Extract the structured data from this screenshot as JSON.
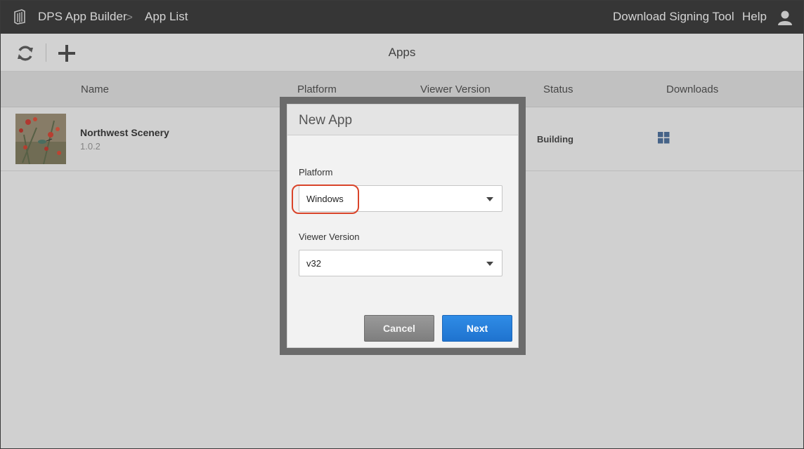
{
  "topbar": {
    "app_name": "DPS App Builder",
    "separator": ">",
    "page": "App List",
    "download_tool": "Download Signing Tool",
    "help": "Help"
  },
  "toolbar": {
    "title": "Apps",
    "refresh_icon": "refresh-icon",
    "add_icon": "plus-icon"
  },
  "table": {
    "columns": [
      "Name",
      "Platform",
      "Viewer Version",
      "Status",
      "Downloads"
    ],
    "rows": [
      {
        "name": "Northwest Scenery",
        "version": "1.0.2",
        "status": "Building",
        "download_icon": "windows-icon"
      }
    ]
  },
  "dialog": {
    "title": "New App",
    "platform_label": "Platform",
    "platform_value": "Windows",
    "viewer_label": "Viewer Version",
    "viewer_value": "v32",
    "cancel_label": "Cancel",
    "next_label": "Next"
  },
  "colors": {
    "topbar": "#262626",
    "primary_button": "#2680dc",
    "highlight": "#d9442a"
  }
}
